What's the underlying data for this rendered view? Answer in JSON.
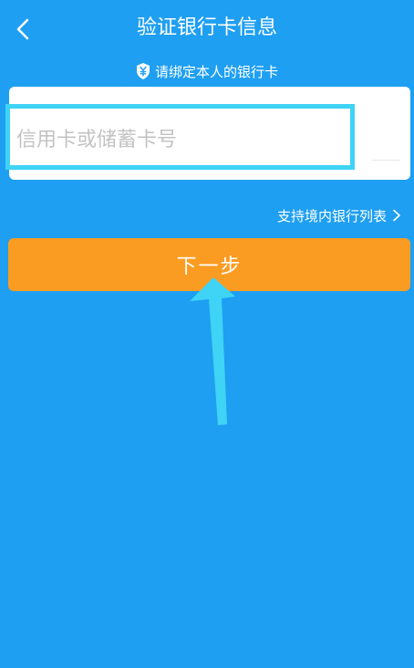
{
  "header": {
    "title": "验证银行卡信息"
  },
  "notice": {
    "text": "请绑定本人的银行卡"
  },
  "card_form": {
    "placeholder": "信用卡或储蓄卡号",
    "value": ""
  },
  "bank_list_link": {
    "label": "支持境内银行列表"
  },
  "next_button": {
    "label": "下一步"
  },
  "colors": {
    "background": "#1e9ff2",
    "button": "#fb9c22",
    "highlight": "#3fd3f5"
  },
  "icons": {
    "back": "back-arrow-icon",
    "shield": "shield-yen-icon",
    "chevron": "chevron-right-icon",
    "pointer_arrow": "pointer-arrow"
  }
}
